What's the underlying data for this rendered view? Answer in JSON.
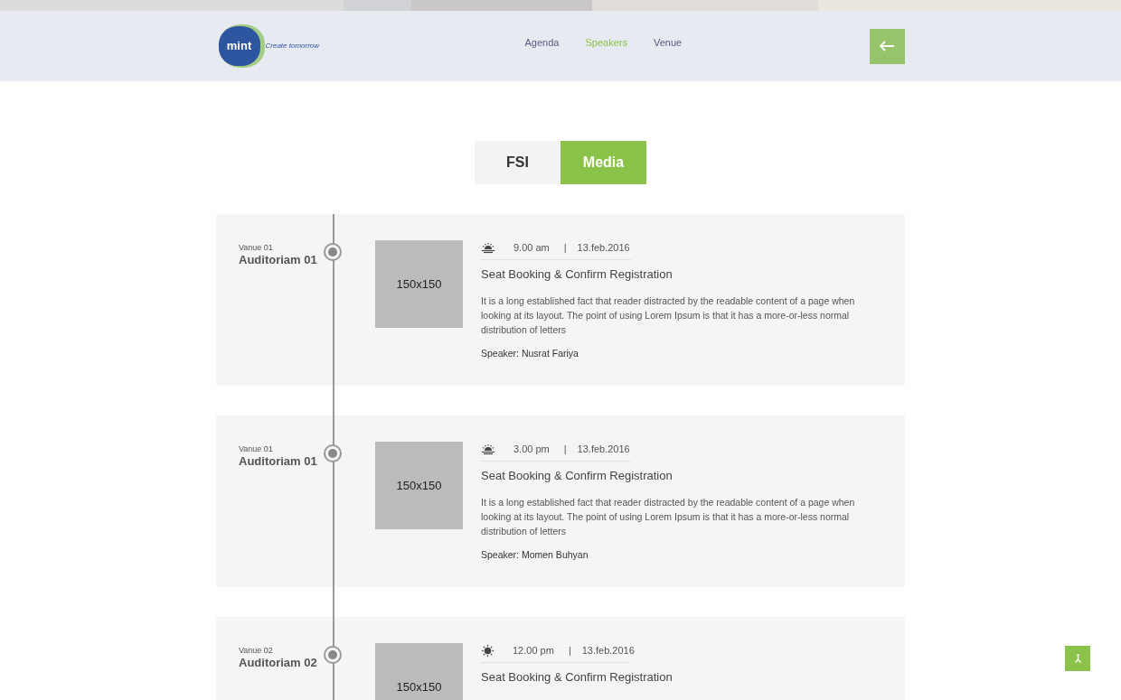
{
  "header": {
    "logo": {
      "name": "mint",
      "tagline": "Create tomorrow"
    },
    "nav": [
      {
        "label": "Agenda",
        "selected": false
      },
      {
        "label": "Speakers",
        "selected": true
      },
      {
        "label": "Venue",
        "selected": false
      }
    ]
  },
  "tabs": [
    {
      "label": "FSI",
      "selected": false
    },
    {
      "label": "Media",
      "selected": true
    }
  ],
  "sessions": [
    {
      "venue": "Vanue 01",
      "room": "Auditoriam 01",
      "image": "150x150",
      "kind": "sunrise",
      "time": "9.00 am",
      "separator": "|",
      "date": "13.feb.2016",
      "title": "Seat Booking & Confirm Registration",
      "description": "It is a long established fact that reader distracted by the readable content of a page when looking at its layout. The point of using Lorem Ipsum is that it has a more-or-less normal distribution of letters",
      "speaker": "Speaker: Nusrat Fariya"
    },
    {
      "venue": "Vanue 01",
      "room": "Auditoriam 01",
      "image": "150x150",
      "kind": "sunrise",
      "time": "3.00 pm",
      "separator": "|",
      "date": "13.feb.2016",
      "title": "Seat Booking & Confirm Registration",
      "description": "It is a long established fact that reader distracted by the readable content of a page when looking at its layout. The point of using Lorem Ipsum is that it has a more-or-less normal distribution of letters",
      "speaker": "Speaker: Momen Buhyan"
    },
    {
      "venue": "Vanue 02",
      "room": "Auditoriam 02",
      "image": "150x150",
      "kind": "sun",
      "time": "12.00 pm",
      "separator": "|",
      "date": "13.feb.2016",
      "title": "Seat Booking & Confirm Registration"
    }
  ]
}
